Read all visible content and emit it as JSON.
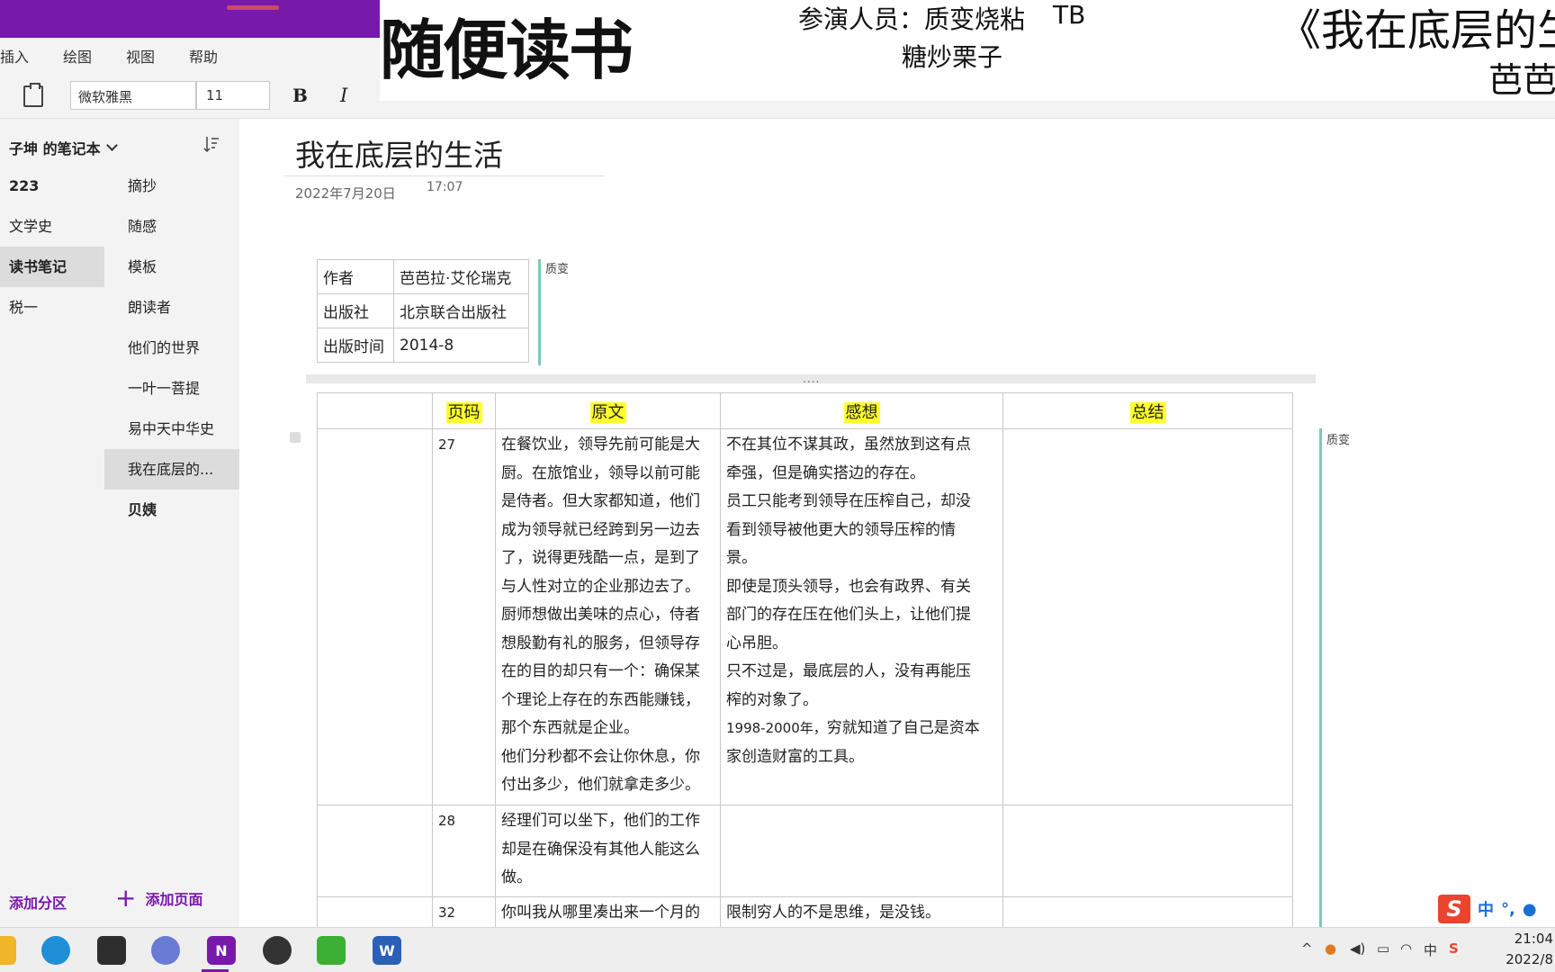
{
  "ribbon": {
    "tabs": [
      "插入",
      "绘图",
      "视图",
      "帮助"
    ],
    "font_name": "微软雅黑",
    "font_size": "11",
    "bold_label": "B",
    "italic_label": "I"
  },
  "overlay": {
    "title": "随便读书",
    "cast_label": "参演人员：质变烧粘",
    "cast_second": "糖炒栗子",
    "cast_tb": "TB",
    "book_title": "《我在底层的生活",
    "author": "芭芭拉"
  },
  "sidebar": {
    "notebook_name": "子坤 的笔记本",
    "sections": [
      {
        "label": "223",
        "bold": true
      },
      {
        "label": "文学史"
      },
      {
        "label": "读书笔记",
        "selected": true,
        "bold": true
      },
      {
        "label": "税一"
      }
    ],
    "pages": [
      {
        "label": "摘抄"
      },
      {
        "label": "随感"
      },
      {
        "label": "模板"
      },
      {
        "label": "朗读者"
      },
      {
        "label": "他们的世界"
      },
      {
        "label": "一叶一菩提"
      },
      {
        "label": "易中天中华史"
      },
      {
        "label": "我在底层的...",
        "selected": true
      },
      {
        "label": "贝姨",
        "bold": true
      }
    ],
    "add_section": "添加分区",
    "add_page": "添加页面"
  },
  "page": {
    "title": "我在底层的生活",
    "date": "2022年7月20日",
    "time": "17:07",
    "info": [
      {
        "key": "作者",
        "value": "芭芭拉·艾伦瑞克"
      },
      {
        "key": "出版社",
        "value": "北京联合出版社"
      },
      {
        "key": "出版时间",
        "value": "2014-8"
      }
    ],
    "author_tag": "质变",
    "table": {
      "headers": [
        "",
        "页码",
        "原文",
        "感想",
        "总结"
      ],
      "rows": [
        {
          "page": "27",
          "original": [
            "在餐饮业，领导先前可能是大",
            "厨。在旅馆业，领导以前可能",
            "是侍者。但大家都知道，他们",
            "成为领导就已经跨到另一边去",
            "了，说得更残酷一点，是到了",
            "与人性对立的企业那边去了。",
            "厨师想做出美味的点心，侍者",
            "想殷勤有礼的服务，但领导存",
            "在的目的却只有一个：确保某",
            "个理论上存在的东西能赚钱，",
            "那个东西就是企业。",
            "他们分秒都不会让你休息，你",
            "付出多少，他们就拿走多少。"
          ],
          "thought": [
            "不在其位不谋其政，虽然放到这有点",
            "牵强，但是确实搭边的存在。",
            "员工只能考到领导在压榨自己，却没",
            "看到领导被他更大的领导压榨的情",
            "景。",
            "即使是顶头领导，也会有政界、有关",
            "部门的存在压在他们头上，让他们提",
            "心吊胆。",
            "只不过是，最底层的人，没有再能压",
            "榨的对象了。"
          ],
          "thought_small": "1998-2000年，",
          "thought_tail": [
            "穷就知道了自己是资本",
            "家创造财富的工具。"
          ],
          "summary": ""
        },
        {
          "page": "28",
          "original": [
            "经理们可以坐下，他们的工作",
            "却是在确保没有其他人能这么",
            "做。"
          ],
          "thought": [],
          "summary": ""
        },
        {
          "page": "32",
          "original": [
            "你叫我从哪里凑出来一个月的"
          ],
          "thought": [
            "限制穷人的不是思维，是没钱。"
          ],
          "summary": ""
        }
      ]
    },
    "table_tag": "质变"
  },
  "ime": {
    "logo": "S",
    "lang": "中",
    "punc": "°,"
  },
  "taskbar": {
    "clock_time": "21:04",
    "clock_date": "2022/8"
  },
  "colors": {
    "onenote_purple": "#7719aa",
    "highlight": "#ffff2b",
    "author_bar": "#7fc9b4"
  }
}
